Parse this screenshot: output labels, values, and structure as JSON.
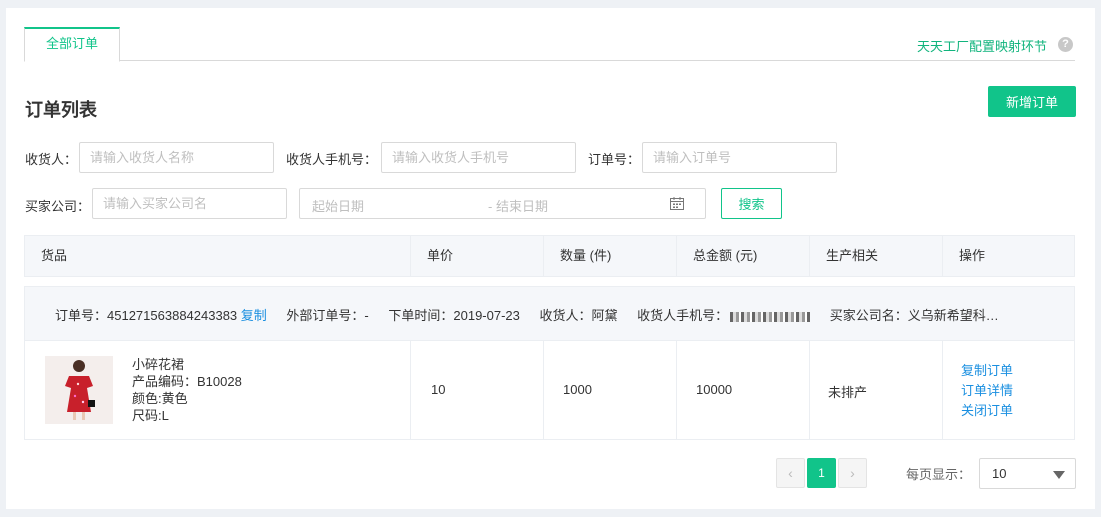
{
  "tabs": {
    "all_orders": "全部订单"
  },
  "config_link": "天天工厂配置映射环节",
  "help_symbol": "?",
  "page_title": "订单列表",
  "add_order_button": "新增订单",
  "filters": {
    "consignee_label": "收货人：",
    "consignee_placeholder": "请输入收货人名称",
    "phone_label": "收货人手机号：",
    "phone_placeholder": "请输入收货人手机号",
    "order_no_label": "订单号：",
    "order_no_placeholder": "请输入订单号",
    "company_label": "买家公司：",
    "company_placeholder": "请输入买家公司名",
    "start_date_placeholder": "起始日期",
    "end_date_placeholder": "- 结束日期",
    "search_button": "搜索"
  },
  "table": {
    "columns": [
      "货品",
      "单价",
      "数量 (件)",
      "总金额 (元)",
      "生产相关",
      "操作"
    ]
  },
  "order": {
    "order_no_label": "订单号：",
    "order_no": "451271563884243383",
    "copy_label": "复制",
    "external_no": "外部订单号：-",
    "order_time": "下单时间：2019-07-23",
    "consignee": "收货人：阿黛",
    "phone_label": "收货人手机号：",
    "company": "买家公司名：义乌新希望科…",
    "product_name": "小碎花裙",
    "product_code": "产品编码：B10028",
    "product_color": "颜色:黄色",
    "product_size": "尺码:L",
    "unit_price": "10",
    "quantity": "1000",
    "total": "10000",
    "production_status": "未排产",
    "actions": [
      "复制订单",
      "订单详情",
      "关闭订单"
    ]
  },
  "pagination": {
    "prev": "‹",
    "current": "1",
    "next": "›",
    "per_page_label": "每页显示：",
    "per_page_value": "10"
  },
  "colors": {
    "accent": "#11c48a",
    "link": "#1a8fe0"
  },
  "icons": [
    "help-icon",
    "calendar-icon",
    "chevron-left-icon",
    "chevron-right-icon",
    "caret-down-icon"
  ]
}
